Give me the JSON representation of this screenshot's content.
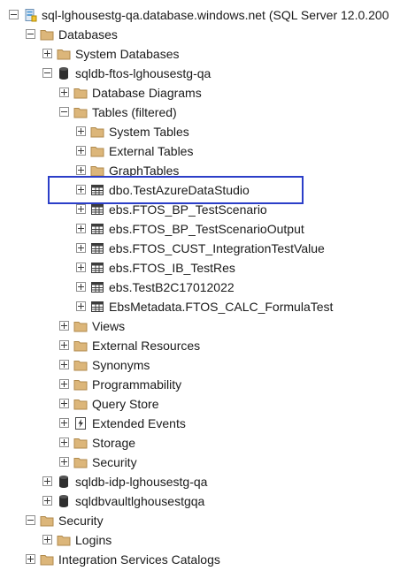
{
  "tree": [
    {
      "depth": 0,
      "label": "sql-lghousestg-qa.database.windows.net (SQL Server 12.0.200",
      "icon": "server",
      "toggle": "minus"
    },
    {
      "depth": 1,
      "label": "Databases",
      "icon": "folder",
      "toggle": "minus"
    },
    {
      "depth": 2,
      "label": "System Databases",
      "icon": "folder",
      "toggle": "plus"
    },
    {
      "depth": 2,
      "label": "sqldb-ftos-lghousestg-qa",
      "icon": "database",
      "toggle": "minus"
    },
    {
      "depth": 3,
      "label": "Database Diagrams",
      "icon": "folder",
      "toggle": "plus"
    },
    {
      "depth": 3,
      "label": "Tables (filtered)",
      "icon": "folder",
      "toggle": "minus"
    },
    {
      "depth": 4,
      "label": "System Tables",
      "icon": "folder",
      "toggle": "plus"
    },
    {
      "depth": 4,
      "label": "External Tables",
      "icon": "folder",
      "toggle": "plus"
    },
    {
      "depth": 4,
      "label": "GraphTables",
      "icon": "folder",
      "toggle": "plus"
    },
    {
      "depth": 4,
      "label": "dbo.TestAzureDataStudio",
      "icon": "table",
      "toggle": "plus"
    },
    {
      "depth": 4,
      "label": "ebs.FTOS_BP_TestScenario",
      "icon": "table",
      "toggle": "plus"
    },
    {
      "depth": 4,
      "label": "ebs.FTOS_BP_TestScenarioOutput",
      "icon": "table",
      "toggle": "plus"
    },
    {
      "depth": 4,
      "label": "ebs.FTOS_CUST_IntegrationTestValue",
      "icon": "table",
      "toggle": "plus"
    },
    {
      "depth": 4,
      "label": "ebs.FTOS_IB_TestRes",
      "icon": "table",
      "toggle": "plus"
    },
    {
      "depth": 4,
      "label": "ebs.TestB2C17012022",
      "icon": "table",
      "toggle": "plus"
    },
    {
      "depth": 4,
      "label": "EbsMetadata.FTOS_CALC_FormulaTest",
      "icon": "table",
      "toggle": "plus"
    },
    {
      "depth": 3,
      "label": "Views",
      "icon": "folder",
      "toggle": "plus"
    },
    {
      "depth": 3,
      "label": "External Resources",
      "icon": "folder",
      "toggle": "plus"
    },
    {
      "depth": 3,
      "label": "Synonyms",
      "icon": "folder",
      "toggle": "plus"
    },
    {
      "depth": 3,
      "label": "Programmability",
      "icon": "folder",
      "toggle": "plus"
    },
    {
      "depth": 3,
      "label": "Query Store",
      "icon": "folder",
      "toggle": "plus"
    },
    {
      "depth": 3,
      "label": "Extended Events",
      "icon": "events",
      "toggle": "plus"
    },
    {
      "depth": 3,
      "label": "Storage",
      "icon": "folder",
      "toggle": "plus"
    },
    {
      "depth": 3,
      "label": "Security",
      "icon": "folder",
      "toggle": "plus"
    },
    {
      "depth": 2,
      "label": "sqldb-idp-lghousestg-qa",
      "icon": "database",
      "toggle": "plus"
    },
    {
      "depth": 2,
      "label": "sqldbvaultlghousestgqa",
      "icon": "database",
      "toggle": "plus"
    },
    {
      "depth": 1,
      "label": "Security",
      "icon": "folder",
      "toggle": "minus"
    },
    {
      "depth": 2,
      "label": "Logins",
      "icon": "folder",
      "toggle": "plus"
    },
    {
      "depth": 1,
      "label": "Integration Services Catalogs",
      "icon": "folder",
      "toggle": "plus"
    }
  ],
  "highlighted_item": "dbo.TestAzureDataStudio",
  "colors": {
    "highlight_border": "#2b3ec8",
    "folder_fill": "#dcb67a",
    "folder_stroke": "#b08a4c",
    "database_fill": "#2e2e2e",
    "table_stroke": "#3c3c3c",
    "server_fill": "#5aa0d8"
  }
}
